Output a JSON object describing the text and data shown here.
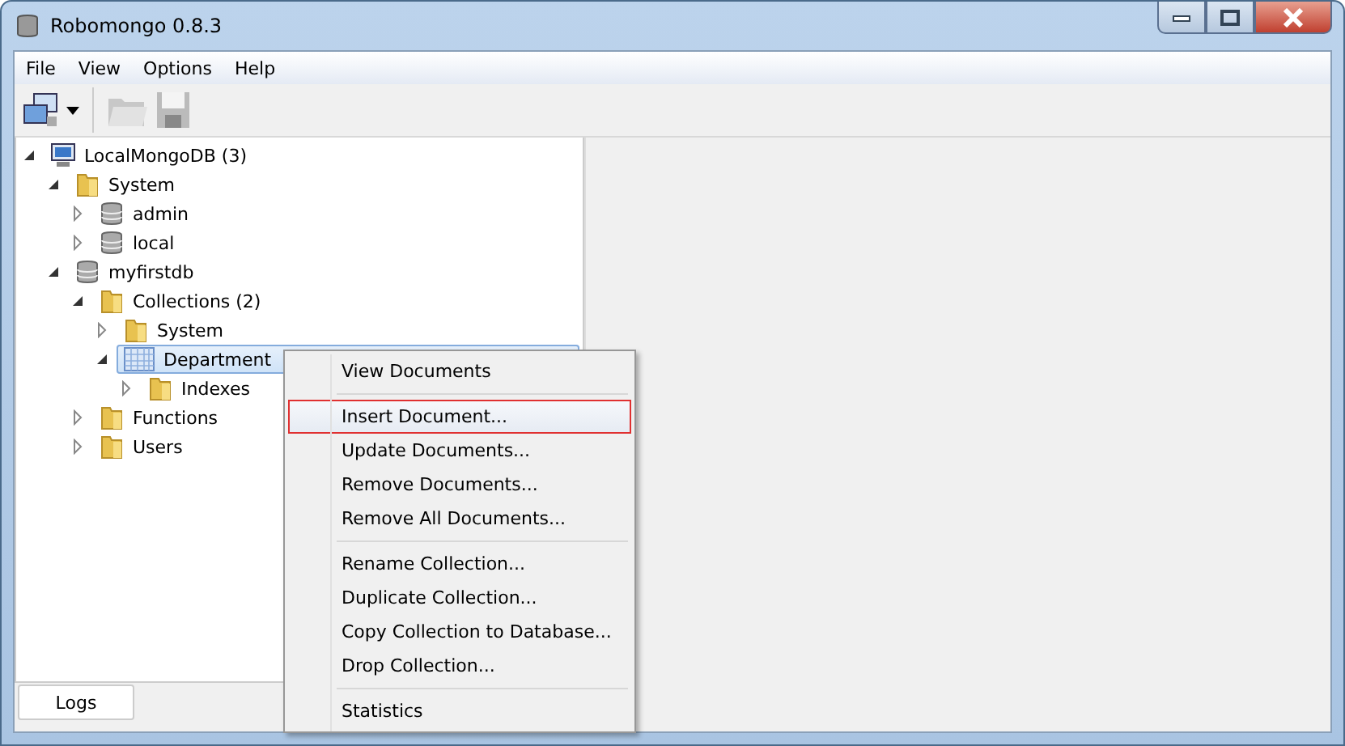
{
  "window": {
    "title": "Robomongo 0.8.3"
  },
  "menu": [
    "File",
    "View",
    "Options",
    "Help"
  ],
  "tree": [
    {
      "label": "LocalMongoDB (3)",
      "kind": "server",
      "expanded": true,
      "selected": false,
      "children": [
        {
          "label": "System",
          "kind": "folder",
          "expanded": true,
          "selected": false,
          "children": [
            {
              "label": "admin",
              "kind": "database",
              "expanded": false,
              "selected": false
            },
            {
              "label": "local",
              "kind": "database",
              "expanded": false,
              "selected": false
            }
          ]
        },
        {
          "label": "myfirstdb",
          "kind": "database",
          "expanded": true,
          "selected": false,
          "children": [
            {
              "label": "Collections (2)",
              "kind": "folder",
              "expanded": true,
              "selected": false,
              "children": [
                {
                  "label": "System",
                  "kind": "folder",
                  "expanded": false,
                  "selected": false
                },
                {
                  "label": "Department",
                  "kind": "collection",
                  "expanded": true,
                  "selected": true,
                  "children": [
                    {
                      "label": "Indexes",
                      "kind": "folder",
                      "expanded": false,
                      "selected": false
                    }
                  ]
                }
              ]
            },
            {
              "label": "Functions",
              "kind": "folder",
              "expanded": false,
              "selected": false
            },
            {
              "label": "Users",
              "kind": "folder",
              "expanded": false,
              "selected": false
            }
          ]
        }
      ]
    }
  ],
  "logs_tab": "Logs",
  "context_menu": [
    [
      {
        "label": "View Documents",
        "highlighted": false
      }
    ],
    [
      {
        "label": "Insert Document...",
        "highlighted": true
      },
      {
        "label": "Update Documents...",
        "highlighted": false
      },
      {
        "label": "Remove Documents...",
        "highlighted": false
      },
      {
        "label": "Remove All Documents...",
        "highlighted": false
      }
    ],
    [
      {
        "label": "Rename Collection...",
        "highlighted": false
      },
      {
        "label": "Duplicate Collection...",
        "highlighted": false
      },
      {
        "label": "Copy Collection to Database...",
        "highlighted": false
      },
      {
        "label": "Drop Collection...",
        "highlighted": false
      }
    ],
    [
      {
        "label": "Statistics",
        "highlighted": false
      }
    ]
  ]
}
